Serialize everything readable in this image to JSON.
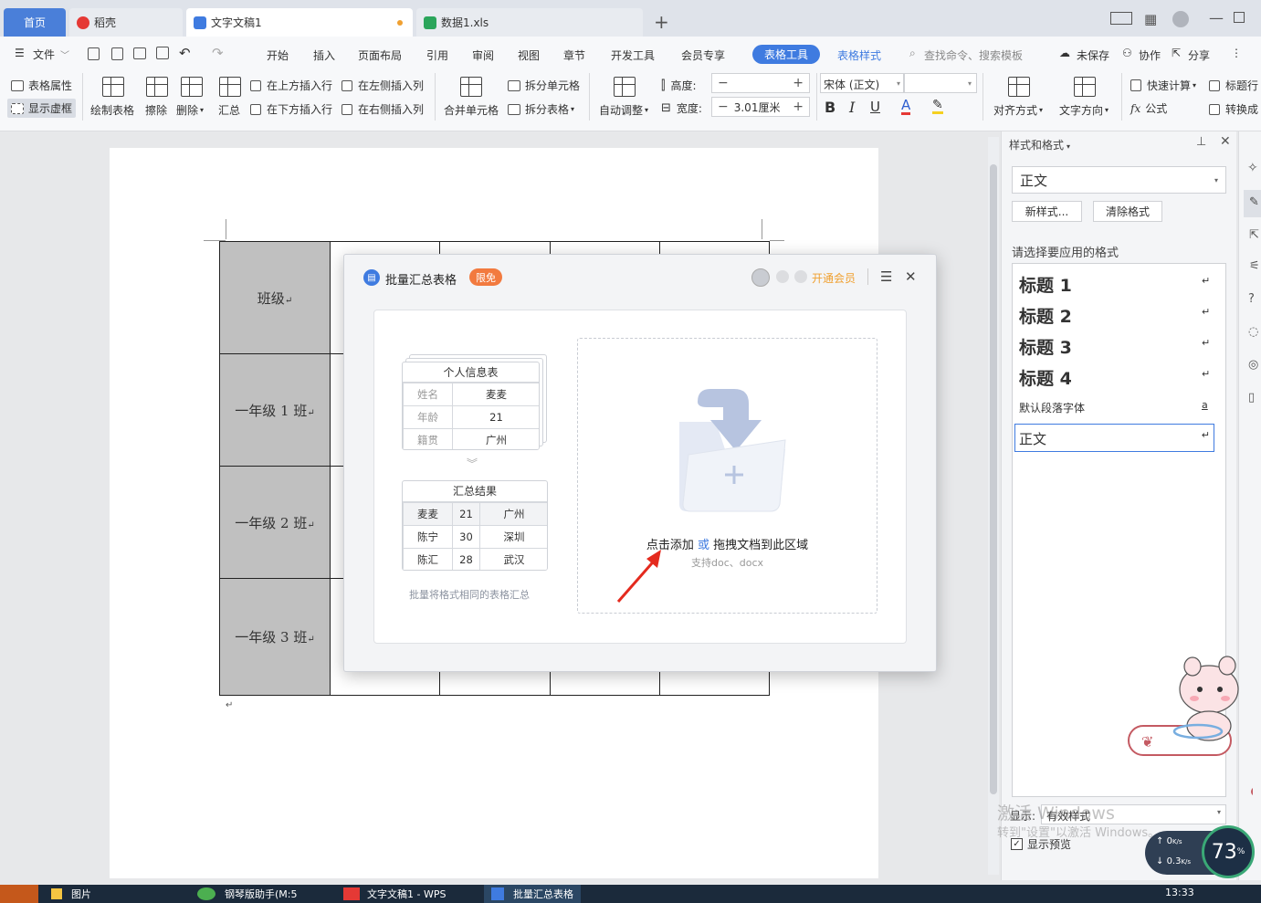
{
  "tabs": {
    "home": "首页",
    "daoke": "稻壳",
    "doc": "文字文稿1",
    "xls": "数据1.xls",
    "new": "+"
  },
  "menu": {
    "file": "文件",
    "start": "开始",
    "insert": "插入",
    "layout": "页面布局",
    "ref": "引用",
    "review": "审阅",
    "view": "视图",
    "chapter": "章节",
    "dev": "开发工具",
    "vip": "会员专享",
    "table_tools": "表格工具",
    "table_style": "表格样式",
    "search": "查找命令、搜索模板",
    "unsaved": "未保存",
    "collab": "协作",
    "share": "分享"
  },
  "ribbon": {
    "table_props": "表格属性",
    "show_grid": "显示虚框",
    "draw_table": "绘制表格",
    "erase": "擦除",
    "delete": "删除",
    "summary": "汇总",
    "ins_above": "在上方插入行",
    "ins_below": "在下方插入行",
    "ins_left": "在左侧插入列",
    "ins_right": "在右侧插入列",
    "merge": "合并单元格",
    "split_cell": "拆分单元格",
    "split_table": "拆分表格",
    "auto_adjust": "自动调整",
    "height_label": "高度:",
    "width_label": "宽度:",
    "width_value": "3.01厘米",
    "font": "宋体 (正文)",
    "align": "对齐方式",
    "text_dir": "文字方向",
    "quick_calc": "快速计算",
    "title_row": "标题行",
    "convert": "转换成",
    "formula": "公式"
  },
  "table": {
    "rows": [
      "班级",
      "一年级 1 班",
      "一年级 2 班",
      "一年级 3 班"
    ]
  },
  "dialog": {
    "title": "批量汇总表格",
    "badge": "限免",
    "vip_link": "开通会员",
    "card_title": "个人信息表",
    "info": [
      [
        "姓名",
        "麦麦"
      ],
      [
        "年龄",
        "21"
      ],
      [
        "籍贯",
        "广州"
      ]
    ],
    "result_title": "汇总结果",
    "results": [
      [
        "麦麦",
        "21",
        "广州"
      ],
      [
        "陈宁",
        "30",
        "深圳"
      ],
      [
        "陈汇",
        "28",
        "武汉"
      ]
    ],
    "caption": "批量将格式相同的表格汇总",
    "add": "点击添加",
    "or": " 或 ",
    "drag": "拖拽文档到此区域",
    "support": "支持doc、docx"
  },
  "panel": {
    "title": "样式和格式",
    "current": "正文",
    "new_style": "新样式...",
    "clear": "清除格式",
    "choose": "请选择要应用的格式",
    "styles": [
      "标题  1",
      "标题  2",
      "标题  3",
      "标题  4"
    ],
    "default_font": "默认段落字体",
    "normal": "正文",
    "show_label": "显示:",
    "show_value": "有效样式",
    "preview": "显示预览"
  },
  "watermark": {
    "line1": "激活 Windows",
    "line2": "转到\"设置\"以激活 Windows。"
  },
  "net": {
    "up": "0",
    "down": "0.3",
    "unit": "K/s",
    "percent": "73",
    "pct_sign": "%"
  },
  "taskbar": {
    "item1": "图片",
    "item2": "钢琴版助手(M:5",
    "item3": "文字文稿1 - WPS",
    "item4": "批量汇总表格",
    "time": "13:33"
  }
}
